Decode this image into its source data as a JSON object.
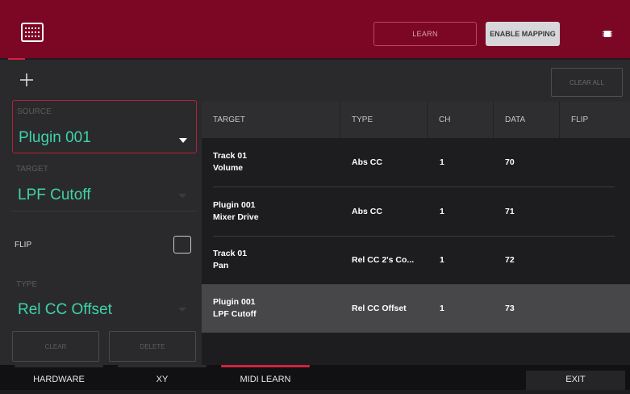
{
  "header": {
    "learn_label": "LEARN",
    "enable_mapping_label": "ENABLE MAPPING",
    "icons": {
      "grid": "grid-menu-icon",
      "chip": "chip-icon"
    },
    "color": "#7c0724"
  },
  "toolbar": {
    "add_icon": "plus-icon",
    "clear_all_label": "CLEAR ALL"
  },
  "left_panel": {
    "source": {
      "label": "SOURCE",
      "value": "Plugin 001"
    },
    "target": {
      "label": "TARGET",
      "value": "LPF Cutoff"
    },
    "flip": {
      "label": "FLIP",
      "checked": false
    },
    "type": {
      "label": "TYPE",
      "value": "Rel CC Offset"
    },
    "clear_label": "CLEAR",
    "delete_label": "DELETE"
  },
  "table": {
    "columns": [
      "TARGET",
      "TYPE",
      "CH",
      "DATA",
      "FLIP"
    ],
    "rows": [
      {
        "target_line1": "Track 01",
        "target_line2": "Volume",
        "type": "Abs CC",
        "ch": "1",
        "data": "70",
        "flip": ""
      },
      {
        "target_line1": "Plugin 001",
        "target_line2": "Mixer Drive",
        "type": "Abs CC",
        "ch": "1",
        "data": "71",
        "flip": ""
      },
      {
        "target_line1": "Track 01",
        "target_line2": "Pan",
        "type": "Rel CC 2's Co...",
        "ch": "1",
        "data": "72",
        "flip": ""
      },
      {
        "target_line1": "Plugin 001",
        "target_line2": "LPF Cutoff",
        "type": "Rel CC Offset",
        "ch": "1",
        "data": "73",
        "flip": ""
      }
    ],
    "selected_row": 3
  },
  "bottom_nav": {
    "tabs": [
      "HARDWARE",
      "XY",
      "MIDI LEARN",
      "EXIT"
    ],
    "active_tab": "MIDI LEARN"
  },
  "colors": {
    "accent": "#3fd4a8",
    "highlight": "#b3203b"
  }
}
